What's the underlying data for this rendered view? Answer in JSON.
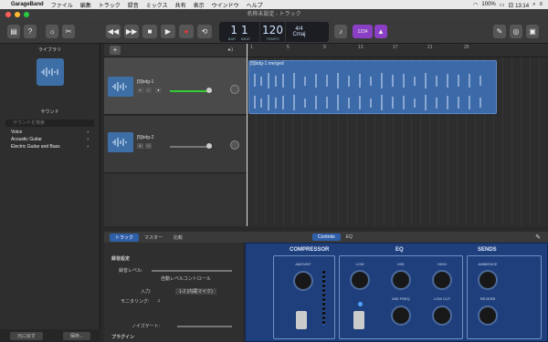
{
  "menubar": {
    "apple": "",
    "app": "GarageBand",
    "items": [
      "ファイル",
      "編集",
      "トラック",
      "録音",
      "ミックス",
      "共有",
      "表示",
      "ウインドウ",
      "ヘルプ"
    ],
    "battery": "100%",
    "time": "日 13:14"
  },
  "window": {
    "title": "名称未設定 - トラック"
  },
  "lcd": {
    "bar": "1",
    "beat": "1",
    "bar_label": "BAR",
    "beat_label": "BEAT",
    "tempo": "120",
    "tempo_label": "TEMPO",
    "sig": "4/4",
    "key": "Cmaj"
  },
  "toolbar": {
    "count": "1234"
  },
  "library": {
    "title": "ライブラリ",
    "sound": "サウンド",
    "search_placeholder": "サウンドを検索",
    "categories": [
      "Voice",
      "Acoustic Guitar",
      "Electric Guitar and Bass"
    ],
    "revert": "元に戻す",
    "save": "保存..."
  },
  "ruler": {
    "ticks": [
      "1",
      "5",
      "9",
      "13",
      "17",
      "21",
      "25"
    ]
  },
  "tracks": [
    {
      "name": "[5]bdg-1"
    },
    {
      "name": "[5]bdg-2"
    }
  ],
  "region": {
    "title": "[5]bdg-1 merged"
  },
  "editor": {
    "tabs": [
      "トラック",
      "マスター",
      "比較"
    ],
    "controls": "Controls",
    "eq": "EQ"
  },
  "settings": {
    "rec_header": "録音設定",
    "rec_level": "録音レベル:",
    "auto": "自動レベルコントロール",
    "input_label": "入力:",
    "input_value": "1-2 (内蔵マイク)",
    "monitor": "モニタリング:",
    "noise": "ノイズゲート:",
    "plugins": "プラグイン"
  },
  "amp": {
    "compressor": "COMPRESSOR",
    "eq": "EQ",
    "sends": "SENDS",
    "amount": "AMOUNT",
    "low": "LOW",
    "mid": "MID",
    "high": "HIGH",
    "midfreq": "MID FREQ",
    "lowcut": "LOW CUT",
    "ambience": "AMBIENCE",
    "reverb": "REVERB"
  }
}
